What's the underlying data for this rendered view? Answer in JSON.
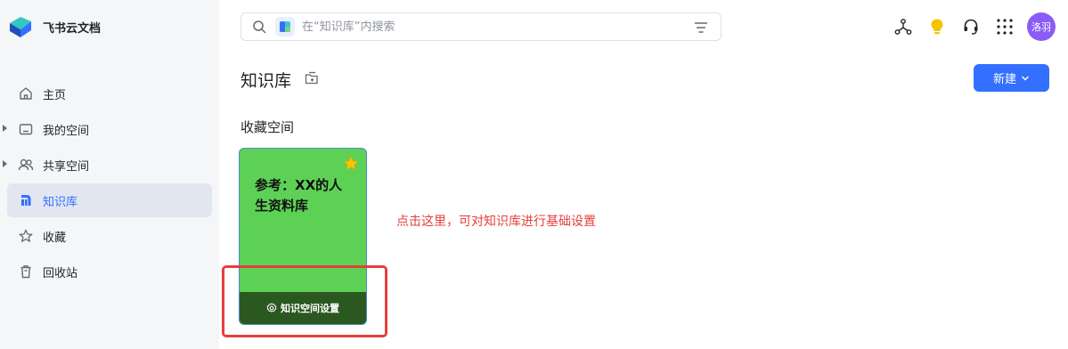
{
  "app": {
    "name": "飞书云文档"
  },
  "sidebar": {
    "items": [
      {
        "label": "主页",
        "icon": "home-icon",
        "active": false,
        "expandable": false
      },
      {
        "label": "我的空间",
        "icon": "folder-icon",
        "active": false,
        "expandable": true
      },
      {
        "label": "共享空间",
        "icon": "people-icon",
        "active": false,
        "expandable": true
      },
      {
        "label": "知识库",
        "icon": "wiki-icon",
        "active": true,
        "expandable": false
      },
      {
        "label": "收藏",
        "icon": "star-outline-icon",
        "active": false,
        "expandable": false
      },
      {
        "label": "回收站",
        "icon": "trash-icon",
        "active": false,
        "expandable": false
      }
    ]
  },
  "search": {
    "placeholder": "在“知识库”内搜索"
  },
  "header": {
    "avatar_text": "洛羽",
    "icons": [
      "network-icon",
      "lightbulb-icon",
      "headset-icon",
      "apps-grid-icon"
    ]
  },
  "main": {
    "title": "知识库",
    "new_button": "新建",
    "section_title": "收藏空间",
    "card": {
      "title": "参考：XX的人生资料库",
      "settings_label": "知识空间设置",
      "color": "#5dd155",
      "footer_color": "#2b5820"
    },
    "annotation": "点击这里，可对知识库进行基础设置"
  },
  "colors": {
    "accent": "#3370ff",
    "annotation": "#e5403c",
    "avatar": "#8a5cf5"
  }
}
